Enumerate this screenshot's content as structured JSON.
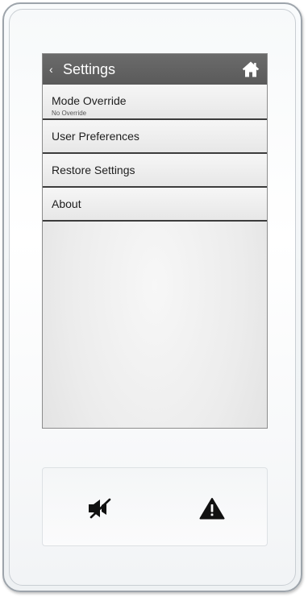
{
  "screen": {
    "title": "Settings",
    "back_glyph": "‹",
    "home_icon": "home-icon"
  },
  "menu": {
    "items": [
      {
        "label": "Mode Override",
        "sublabel": "No Override"
      },
      {
        "label": "User Preferences"
      },
      {
        "label": "Restore Settings"
      },
      {
        "label": "About"
      }
    ]
  },
  "hardware_buttons": {
    "mute_icon": "speaker-muted-icon",
    "alarm_icon": "warning-triangle-icon"
  },
  "colors": {
    "titlebar": "#5f5f5f",
    "menu_divider": "#3c3c3c",
    "device_border": "#9da4ab"
  }
}
